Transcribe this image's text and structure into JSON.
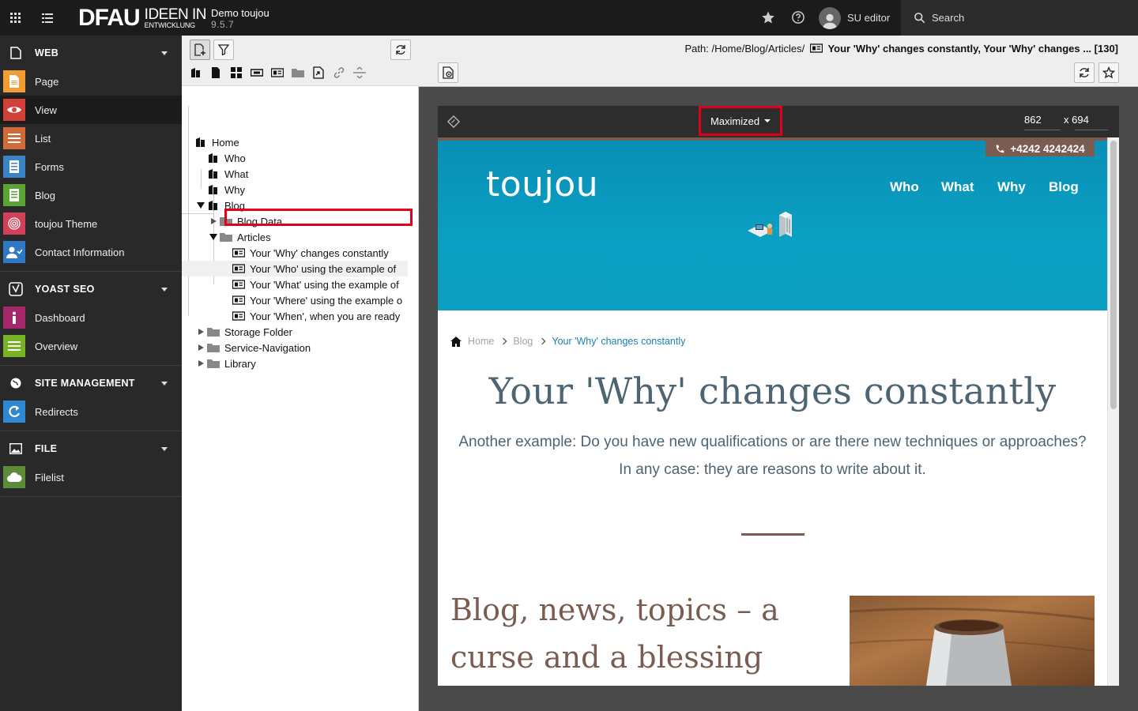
{
  "topbar": {
    "site_name": "Demo toujou",
    "site_version": "9.5.7",
    "logo_main": "DFAU",
    "logo_sub_1": "IDEEN IN",
    "logo_sub_2": "ENTWICKLUNG",
    "user": "SU editor",
    "search_label": "Search"
  },
  "menu": {
    "web": {
      "label": "WEB",
      "items": [
        {
          "label": "Page",
          "color": "#f39c34"
        },
        {
          "label": "View",
          "color": "#d2403a"
        },
        {
          "label": "List",
          "color": "#d26b3a"
        },
        {
          "label": "Forms",
          "color": "#3a83c4"
        },
        {
          "label": "Blog",
          "color": "#5aa335"
        },
        {
          "label": "toujou Theme",
          "color": "#d2405a"
        },
        {
          "label": "Contact Information",
          "color": "#2f78c6"
        }
      ]
    },
    "yoast": {
      "label": "YOAST SEO",
      "items": [
        {
          "label": "Dashboard",
          "color": "#a4286a"
        },
        {
          "label": "Overview",
          "color": "#77b227"
        }
      ]
    },
    "site": {
      "label": "SITE MANAGEMENT",
      "items": [
        {
          "label": "Redirects",
          "color": "#2f88d2"
        }
      ]
    },
    "file": {
      "label": "FILE",
      "items": [
        {
          "label": "Filelist",
          "color": "#5c8b3a"
        }
      ]
    }
  },
  "tree": {
    "home": "Home",
    "who": "Who",
    "what": "What",
    "why": "Why",
    "blog": "Blog",
    "blog_data": "Blog Data",
    "articles": "Articles",
    "art1": "Your 'Why' changes constantly",
    "art2": "Your 'Who' using the example of",
    "art3": "Your 'What' using the example of",
    "art4": "Your 'Where' using the example o",
    "art5": "Your 'When', when you are ready",
    "storage": "Storage Folder",
    "service": "Service-Navigation",
    "library": "Library"
  },
  "docheader": {
    "path_prefix": "Path: /Home/Blog/Articles/",
    "path_title": "Your 'Why' changes constantly, Your 'Why' changes ... [130]"
  },
  "viewmodule": {
    "preset": "Maximized",
    "width": "862",
    "height": "x 694"
  },
  "preview": {
    "phone": "+4242 4242424",
    "brand": "toujou",
    "nav": [
      "Who",
      "What",
      "Why",
      "Blog"
    ],
    "crumb_home": "Home",
    "crumb_blog": "Blog",
    "crumb_current": "Your 'Why' changes constantly",
    "heading": "Your 'Why' changes constantly",
    "lead": "Another example: Do you have new qualifications or are there new techniques or approaches? In any case: they are reasons to write about it.",
    "subheading": "Blog, news, topics – a curse and a blessing"
  },
  "colors": {
    "accent_red": "#e0001a",
    "hero_blue": "#0aa0c3",
    "brown": "#7b5c51",
    "heading_slate": "#4d6472"
  }
}
